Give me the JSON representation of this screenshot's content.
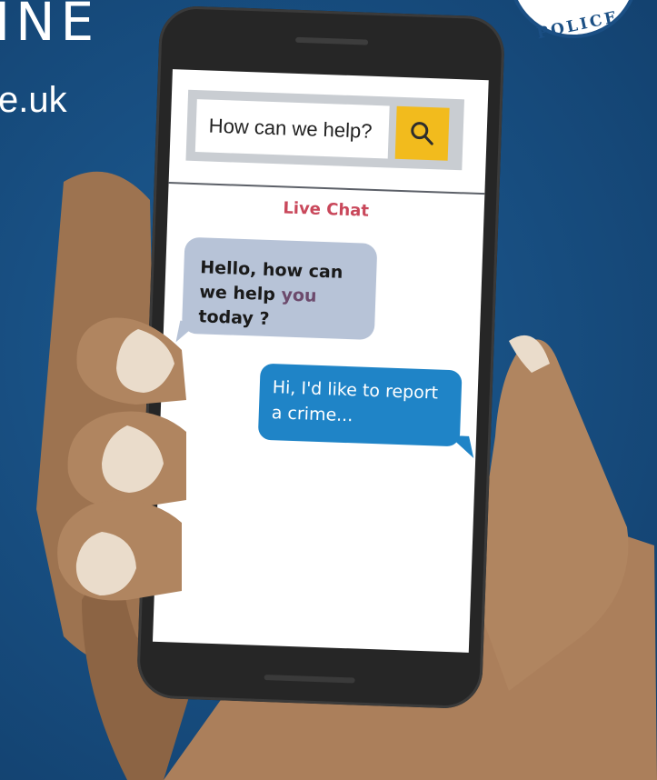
{
  "headline": {
    "line1": "INE",
    "line2": "e.uk"
  },
  "badge": {
    "text": "POLICE"
  },
  "search": {
    "placeholder": "How can we help?",
    "value": "How can we help?"
  },
  "chat": {
    "title": "Live Chat",
    "agent_message": {
      "part1": "Hello, how can we help ",
      "highlight": "you",
      "part2": " today ?"
    },
    "user_message": "Hi, I'd like to report a crime..."
  },
  "colors": {
    "background": "#184f82",
    "search_button": "#f2bb1d",
    "agent_bubble": "#b7c3d7",
    "user_bubble": "#1f84c7",
    "chat_title": "#c9485b",
    "skin": "#b08560"
  },
  "icons": [
    "search-icon",
    "police-badge"
  ]
}
